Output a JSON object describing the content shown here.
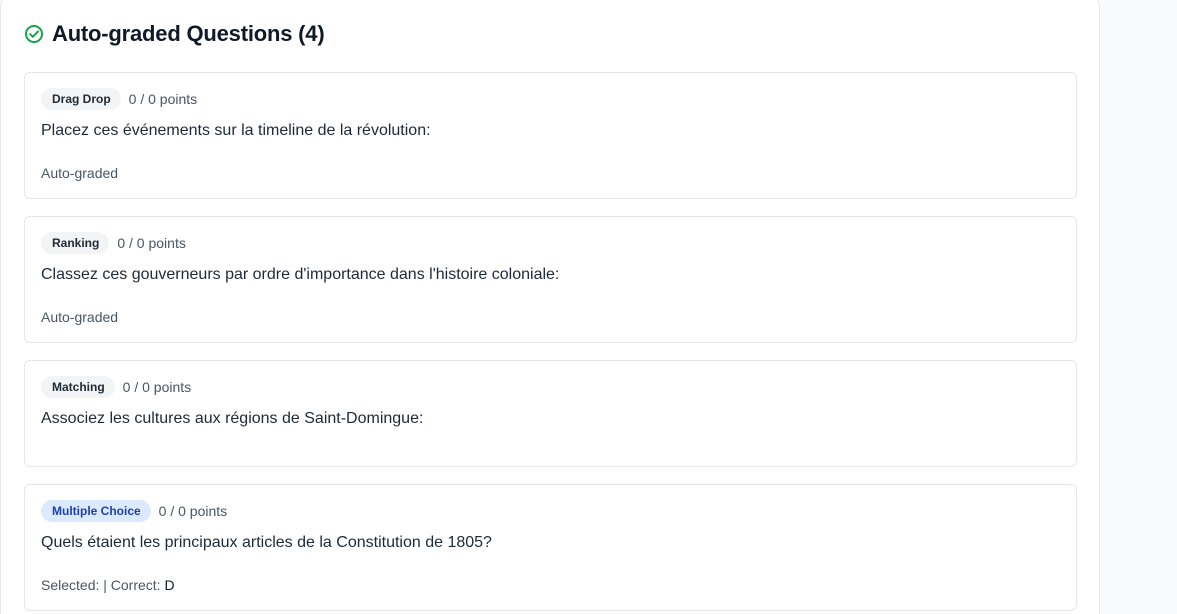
{
  "section": {
    "title": "Auto-graded Questions (4)",
    "icon": "check-circle-icon",
    "icon_color": "#16a34a"
  },
  "questions": [
    {
      "type": "Drag Drop",
      "points": "0 / 0 points",
      "text": "Placez ces événements sur la timeline de la révolution:",
      "footer": "Auto-graded"
    },
    {
      "type": "Ranking",
      "points": "0 / 0 points",
      "text": "Classez ces gouverneurs par ordre d'importance dans l'histoire coloniale:",
      "footer": "Auto-graded"
    },
    {
      "type": "Matching",
      "points": "0 / 0 points",
      "text": "Associez les cultures aux régions de Saint-Domingue:",
      "footer": ""
    },
    {
      "type": "Multiple Choice",
      "points": "0 / 0 points",
      "text": "Quels étaient les principaux articles de la Constitution de 1805?",
      "footer_prefix": "Selected:  | Correct: ",
      "correct": "D"
    }
  ],
  "colors": {
    "badge_default_bg": "#f3f4f6",
    "badge_mc_bg": "#dbeafe",
    "badge_mc_text": "#1e40af"
  }
}
